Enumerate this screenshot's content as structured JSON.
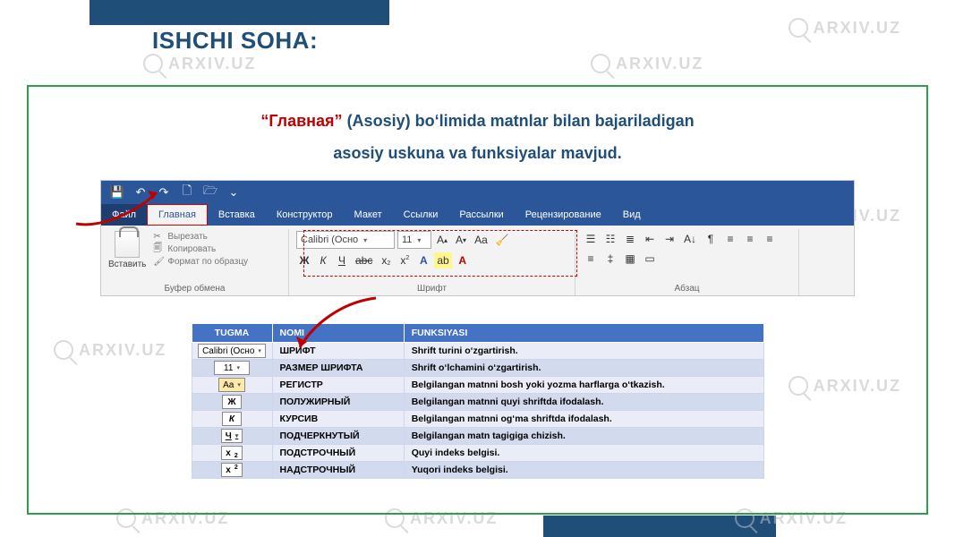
{
  "watermark_text": "ARXIV.UZ",
  "slide_title": "ISHCHI SOHA:",
  "subtitle": {
    "quoted": "“Главная”",
    "rest_line1": " (Asosiy) bo‘limida matnlar bilan bajariladigan",
    "line2": "asosiy uskuna va funksiyalar mavjud."
  },
  "ribbon": {
    "tabs": {
      "file": "Файл",
      "home": "Главная",
      "insert": "Вставка",
      "design": "Конструктор",
      "layout": "Макет",
      "refs": "Ссылки",
      "mail": "Рассылки",
      "review": "Рецензирование",
      "view": "Вид"
    },
    "clipboard": {
      "paste": "Вставить",
      "cut": "Вырезать",
      "copy": "Копировать",
      "format_painter": "Формат по образцу",
      "group_label": "Буфер обмена"
    },
    "font": {
      "name": "Calibri (Осно",
      "size": "11",
      "grow": "A↑",
      "shrink": "A↓",
      "case": "Aa",
      "bold": "Ж",
      "italic": "К",
      "underline": "Ч",
      "strike": "abc",
      "sub": "x₂",
      "sup": "x²",
      "group_label": "Шрифт"
    },
    "paragraph": {
      "group_label": "Абзац"
    }
  },
  "table": {
    "headers": {
      "tugma": "TUGMA",
      "nomi": "NOMI",
      "funksiyasi": "FUNKSIYASI"
    },
    "rows": [
      {
        "tugma_label": "Calibri (Осно",
        "tugma_kind": "combo",
        "nomi": "ШРИФТ",
        "func": "Shrift turini o‘zgartirish."
      },
      {
        "tugma_label": "11",
        "tugma_kind": "combo-small",
        "nomi": "РАЗМЕР ШРИФТА",
        "func": "Shrift o‘lchamini o‘zgartirish."
      },
      {
        "tugma_label": "Aa",
        "tugma_kind": "btn",
        "nomi": "РЕГИСТР",
        "func": "Belgilangan matnni bosh yoki yozma harflarga o‘tkazish."
      },
      {
        "tugma_label": "Ж",
        "tugma_kind": "btn-bold",
        "nomi": "ПОЛУЖИРНЫЙ",
        "func": "Belgilangan matnni quyi shriftda ifodalash."
      },
      {
        "tugma_label": "К",
        "tugma_kind": "btn-italic",
        "nomi": "КУРСИВ",
        "func": "Belgilangan matnni og‘ma shriftda ifodalash."
      },
      {
        "tugma_label": "Ч",
        "tugma_kind": "btn-under",
        "nomi": "ПОДЧЕРКНУТЫЙ",
        "func": "Belgilangan matn tagigiga chizish."
      },
      {
        "tugma_label": "x",
        "tugma_kind": "btn-sub",
        "nomi": "ПОДСТРОЧНЫЙ",
        "func": "Quyi indeks belgisi."
      },
      {
        "tugma_label": "x",
        "tugma_kind": "btn-sup",
        "nomi": "НАДСТРОЧНЫЙ",
        "func": "Yuqori indeks belgisi."
      }
    ]
  }
}
